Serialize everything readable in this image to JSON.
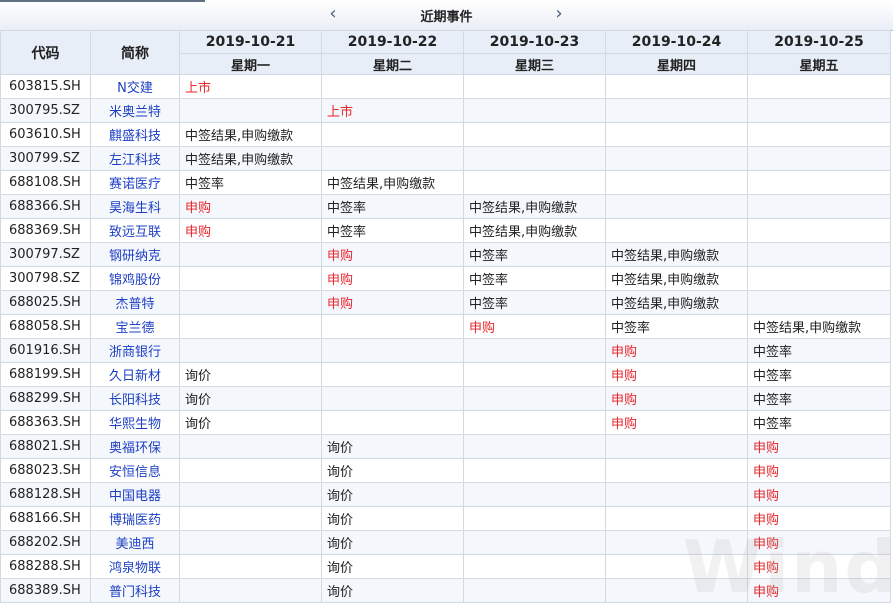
{
  "topbar": {
    "title": "近期事件",
    "prev_icon": "chevron-left-icon",
    "next_icon": "chevron-right-icon"
  },
  "headers": {
    "code": "代码",
    "name": "简称",
    "dates": [
      "2019-10-21",
      "2019-10-22",
      "2019-10-23",
      "2019-10-24",
      "2019-10-25"
    ],
    "weekdays": [
      "星期一",
      "星期二",
      "星期三",
      "星期四",
      "星期五"
    ]
  },
  "colors": {
    "link": "#1d3fc4",
    "highlight": "#e8262b",
    "header_bg": "#e7eef8"
  },
  "rows": [
    {
      "code": "603815.SH",
      "name": "N交建",
      "events": [
        "上市",
        "",
        "",
        "",
        ""
      ]
    },
    {
      "code": "300795.SZ",
      "name": "米奥兰特",
      "events": [
        "",
        "上市",
        "",
        "",
        ""
      ]
    },
    {
      "code": "603610.SH",
      "name": "麒盛科技",
      "events": [
        "中签结果,申购缴款",
        "",
        "",
        "",
        ""
      ]
    },
    {
      "code": "300799.SZ",
      "name": "左江科技",
      "events": [
        "中签结果,申购缴款",
        "",
        "",
        "",
        ""
      ]
    },
    {
      "code": "688108.SH",
      "name": "赛诺医疗",
      "events": [
        "中签率",
        "中签结果,申购缴款",
        "",
        "",
        ""
      ]
    },
    {
      "code": "688366.SH",
      "name": "昊海生科",
      "events": [
        "申购",
        "中签率",
        "中签结果,申购缴款",
        "",
        ""
      ]
    },
    {
      "code": "688369.SH",
      "name": "致远互联",
      "events": [
        "申购",
        "中签率",
        "中签结果,申购缴款",
        "",
        ""
      ]
    },
    {
      "code": "300797.SZ",
      "name": "钢研纳克",
      "events": [
        "",
        "申购",
        "中签率",
        "中签结果,申购缴款",
        ""
      ]
    },
    {
      "code": "300798.SZ",
      "name": "锦鸡股份",
      "events": [
        "",
        "申购",
        "中签率",
        "中签结果,申购缴款",
        ""
      ]
    },
    {
      "code": "688025.SH",
      "name": "杰普特",
      "events": [
        "",
        "申购",
        "中签率",
        "中签结果,申购缴款",
        ""
      ]
    },
    {
      "code": "688058.SH",
      "name": "宝兰德",
      "events": [
        "",
        "",
        "申购",
        "中签率",
        "中签结果,申购缴款"
      ]
    },
    {
      "code": "601916.SH",
      "name": "浙商银行",
      "events": [
        "",
        "",
        "",
        "申购",
        "中签率"
      ]
    },
    {
      "code": "688199.SH",
      "name": "久日新材",
      "events": [
        "询价",
        "",
        "",
        "申购",
        "中签率"
      ]
    },
    {
      "code": "688299.SH",
      "name": "长阳科技",
      "events": [
        "询价",
        "",
        "",
        "申购",
        "中签率"
      ]
    },
    {
      "code": "688363.SH",
      "name": "华熙生物",
      "events": [
        "询价",
        "",
        "",
        "申购",
        "中签率"
      ]
    },
    {
      "code": "688021.SH",
      "name": "奥福环保",
      "events": [
        "",
        "询价",
        "",
        "",
        "申购"
      ]
    },
    {
      "code": "688023.SH",
      "name": "安恒信息",
      "events": [
        "",
        "询价",
        "",
        "",
        "申购"
      ]
    },
    {
      "code": "688128.SH",
      "name": "中国电器",
      "events": [
        "",
        "询价",
        "",
        "",
        "申购"
      ]
    },
    {
      "code": "688166.SH",
      "name": "博瑞医药",
      "events": [
        "",
        "询价",
        "",
        "",
        "申购"
      ]
    },
    {
      "code": "688202.SH",
      "name": "美迪西",
      "events": [
        "",
        "询价",
        "",
        "",
        "申购"
      ]
    },
    {
      "code": "688288.SH",
      "name": "鸿泉物联",
      "events": [
        "",
        "询价",
        "",
        "",
        "申购"
      ]
    },
    {
      "code": "688389.SH",
      "name": "普门科技",
      "events": [
        "",
        "询价",
        "",
        "",
        "申购"
      ]
    }
  ],
  "watermark": "Wind"
}
